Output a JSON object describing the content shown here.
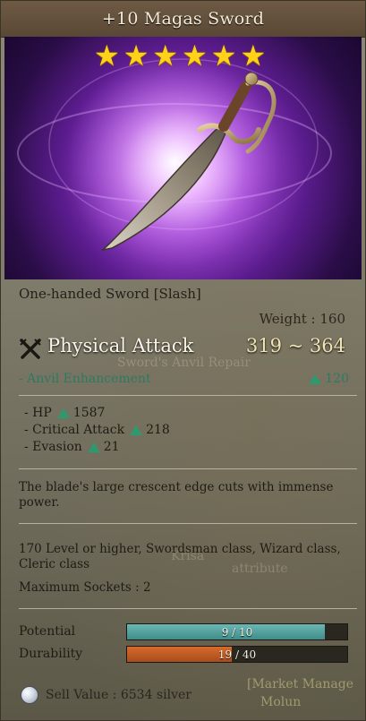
{
  "item": {
    "title": "+10 Magas Sword",
    "stars": [
      "★",
      "★",
      "★",
      "★",
      "★",
      "★"
    ],
    "type": "One-handed Sword [Slash]",
    "weight_label": "Weight : 160",
    "physical_attack_label": "Physical Attack",
    "physical_attack_value": "319 ~ 364",
    "anvil_label": "- Anvil Enhancement",
    "anvil_value": "120",
    "stats": [
      {
        "label": "- HP",
        "value": "1587"
      },
      {
        "label": "- Critical Attack",
        "value": "218"
      },
      {
        "label": "- Evasion",
        "value": "21"
      }
    ],
    "description": "The blade's large crescent edge cuts with immense power.",
    "requirements": "170 Level or higher, Swordsman class, Wizard class, Cleric class",
    "sockets": "Maximum Sockets : 2",
    "potential": {
      "label": "Potential",
      "text": "9 / 10",
      "fraction": 0.9
    },
    "durability": {
      "label": "Durability",
      "text": "19 / 40",
      "fraction": 0.475
    },
    "sell_value": "Sell Value : 6534 silver"
  },
  "background_text": {
    "anvil_repair": "Sword's Anvil Repair",
    "krisa": "Krisa",
    "attribute": "attribute",
    "market_manager": "[Market Manage",
    "molun": "Molun"
  },
  "colors": {
    "star": "#ffd21a",
    "stat_up": "#2d9a6e",
    "potential_bar": "#4f9f9b",
    "durability_bar": "#c25c22"
  },
  "icons": {
    "physical_attack": "crossed-swords-icon",
    "stat_increase": "green-up-triangle-icon",
    "silver": "silver-coin-icon"
  }
}
